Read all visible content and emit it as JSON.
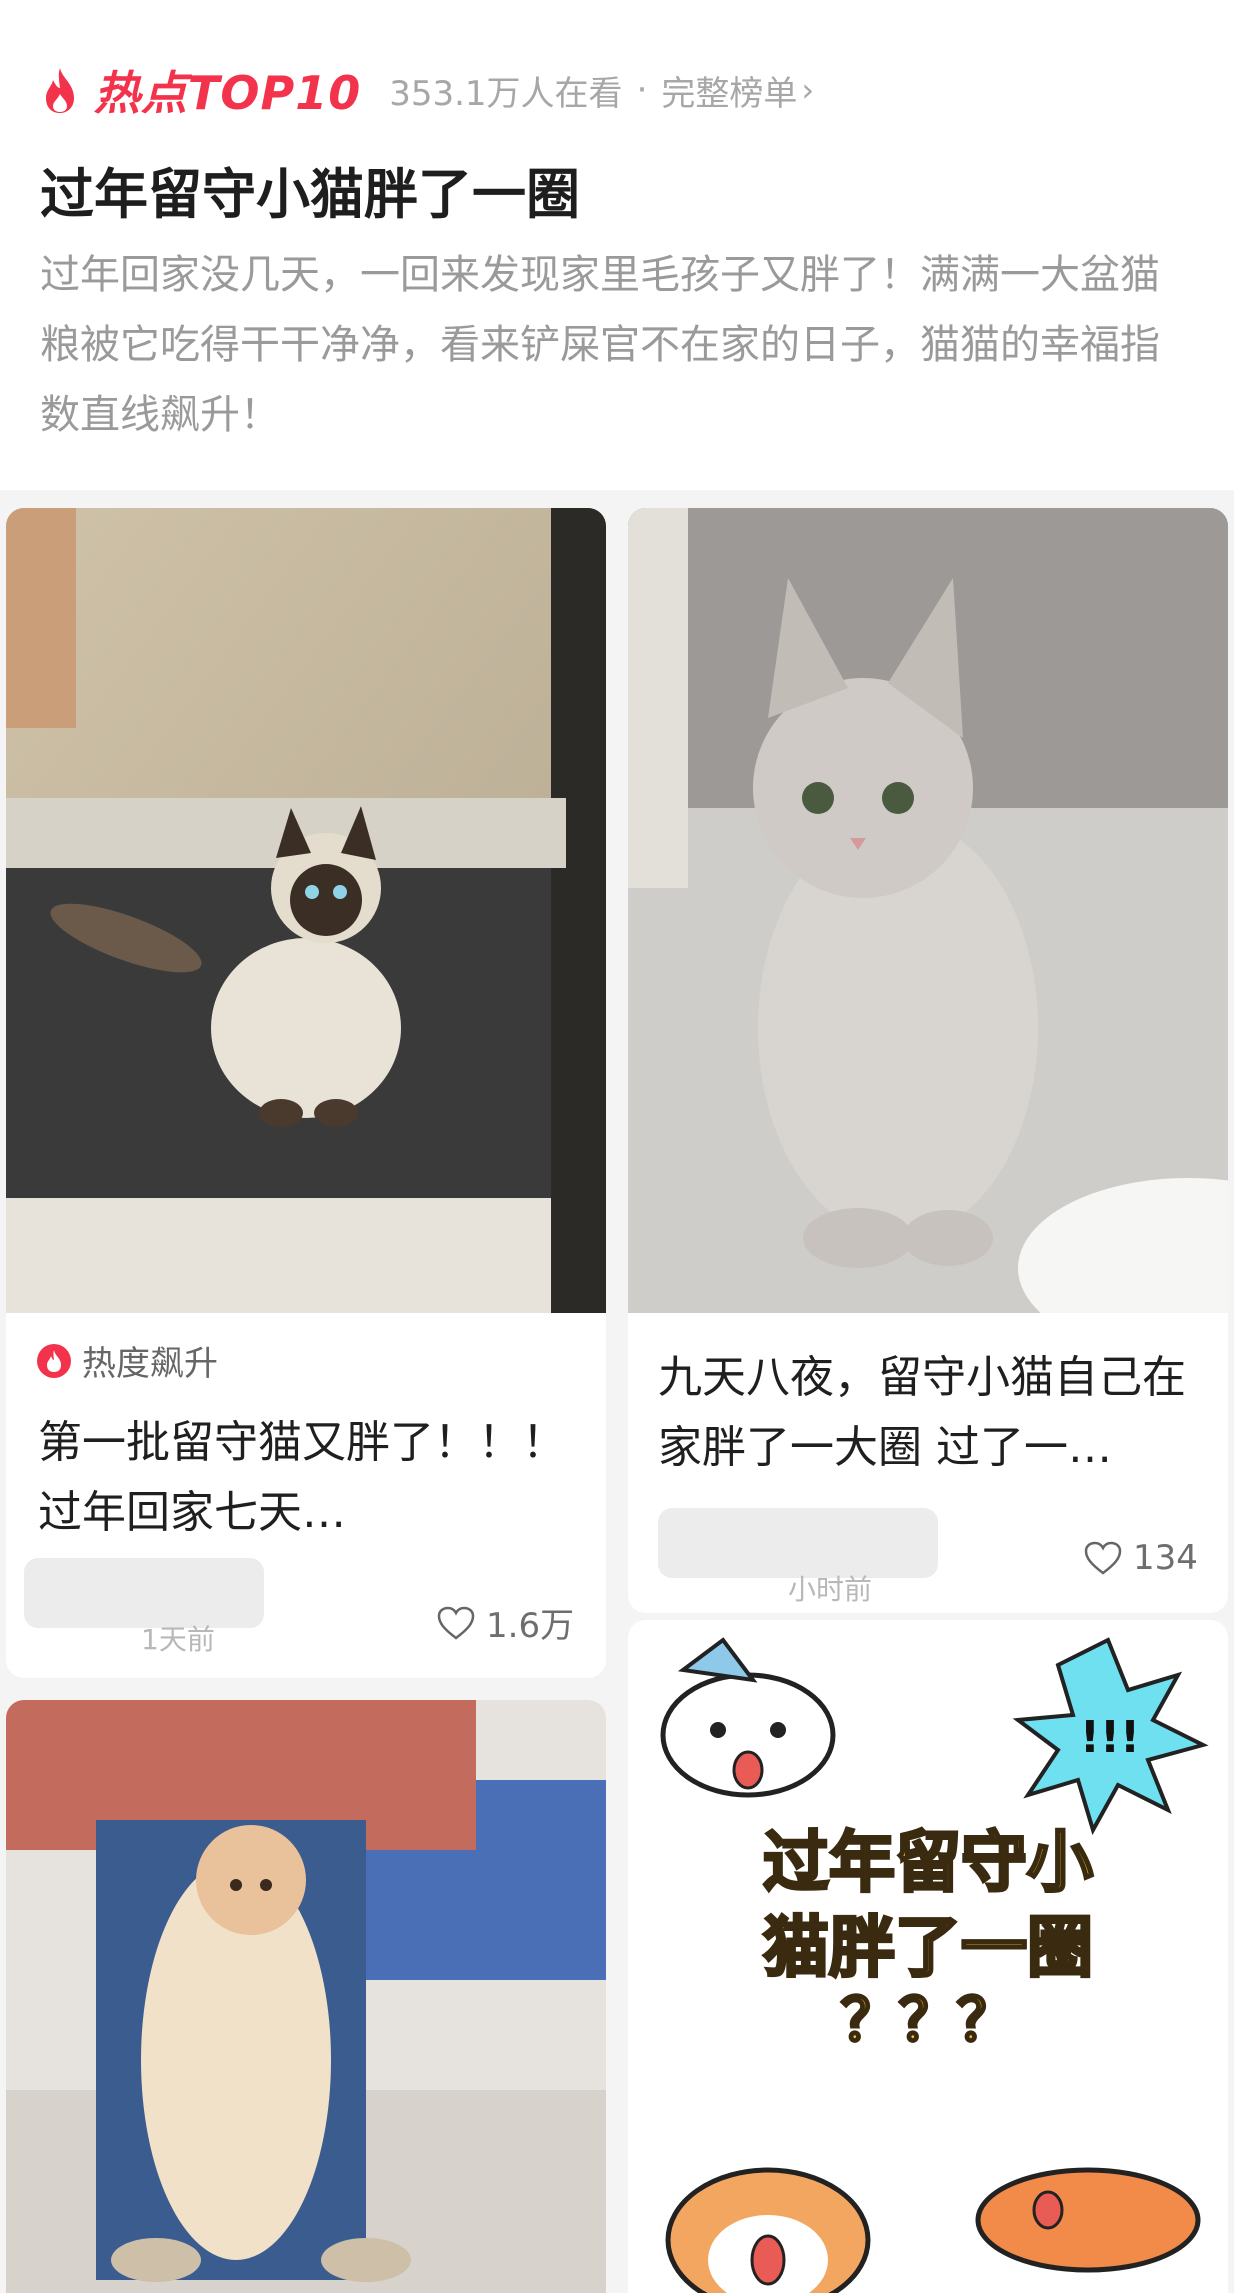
{
  "header": {
    "hot_label": "热点TOP10",
    "viewers": "353.1万人在看",
    "separator": "·",
    "full_list": "完整榜单",
    "chevron": "›",
    "title": "过年留守小猫胖了一圈",
    "description": "过年回家没几天，一回来发现家里毛孩子又胖了！满满一大盆猫粮被它吃得干干净净，看来铲屎官不在家的日子，猫猫的幸福指数直线飙升！"
  },
  "cards": [
    {
      "badge": "热度飙升",
      "title": "第一批留守猫又胖了！！！ 过年回家七天…",
      "time": "1天前",
      "likes": "1.6万",
      "image": "siamese-cat-photo"
    },
    {
      "title": "九天八夜，留守小猫自己在家胖了一大圈 过了一…",
      "time": "小时前",
      "likes": "134",
      "image": "gray-british-shorthair-photo"
    },
    {
      "image": "held-long-hair-cat-photo"
    },
    {
      "image": "cartoon-cats-illustration",
      "text_line1": "过年留守小",
      "text_line2": "猫胖了一圈",
      "text_line3": "？？？",
      "exclaim": "!!!"
    }
  ],
  "colors": {
    "accent": "#f2334b",
    "muted": "#9a9a9a",
    "yellow": "#f5c22b"
  },
  "icons": [
    "flame-icon",
    "chevron-right-icon",
    "heart-icon",
    "hot-badge-icon"
  ]
}
